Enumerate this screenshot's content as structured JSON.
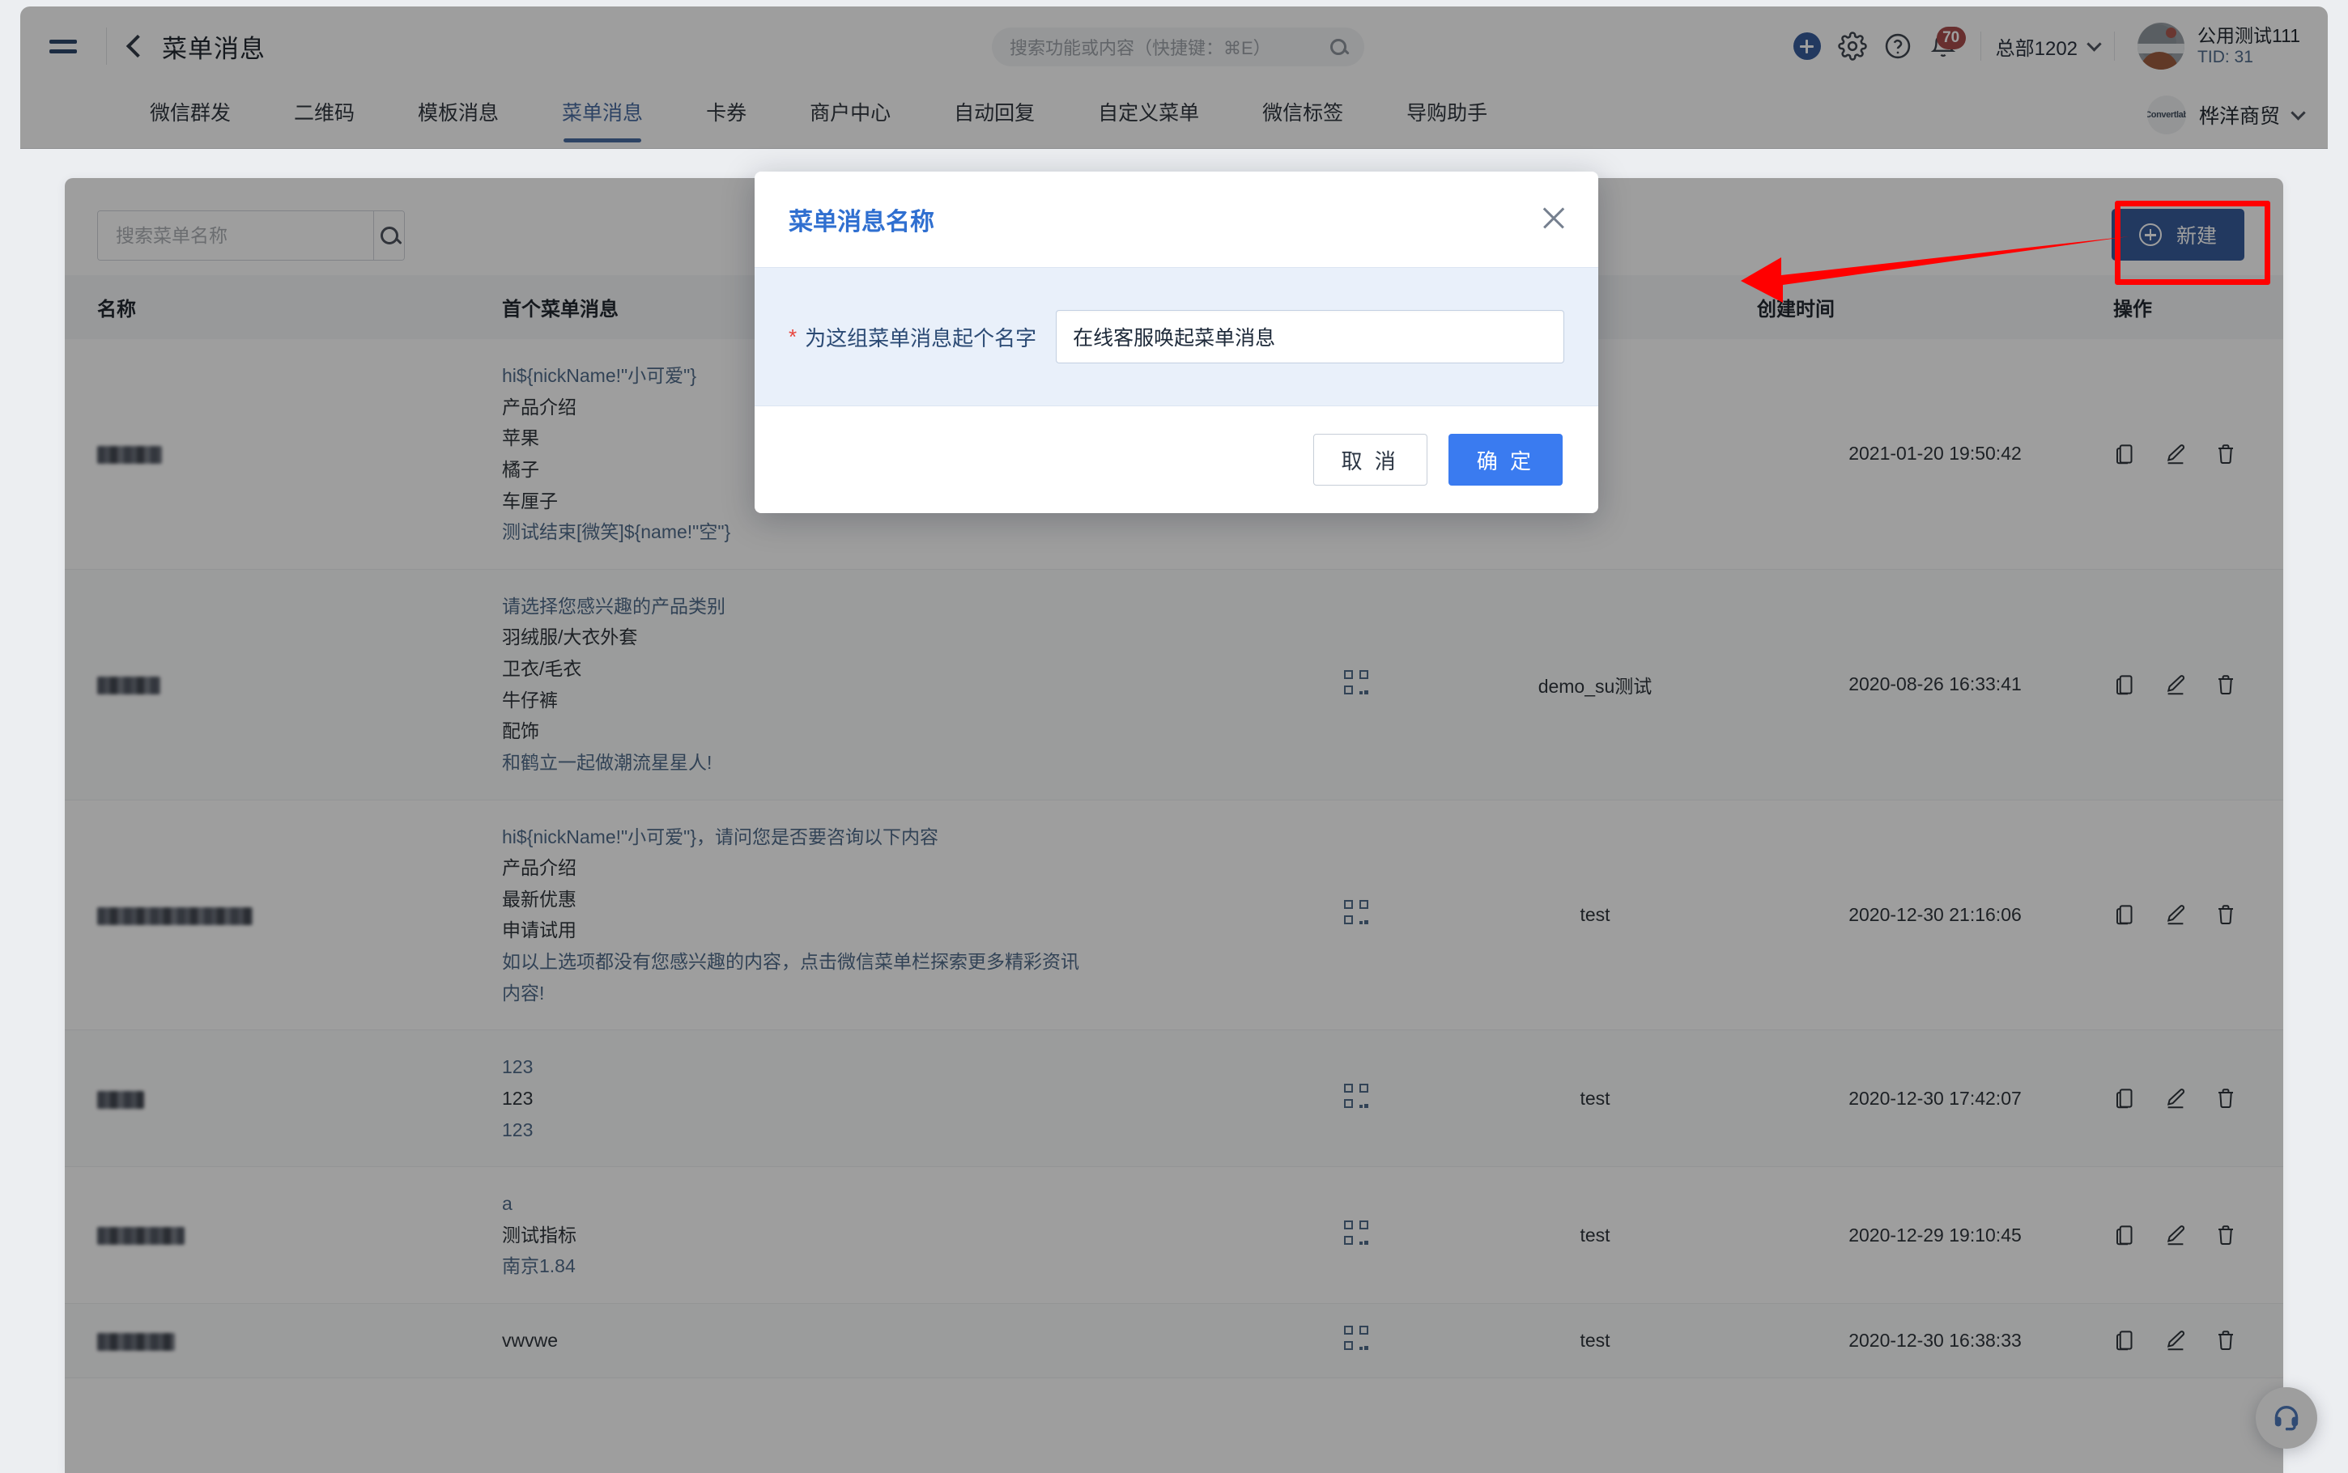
{
  "header": {
    "page_title": "菜单消息",
    "search_placeholder": "搜索功能或内容（快捷键：⌘E）",
    "notification_count": "70",
    "org_selector": "总部1202",
    "user_name": "公用测试111",
    "user_tid": "TID: 31"
  },
  "tabs": {
    "items": [
      {
        "label": "微信群发",
        "active": false
      },
      {
        "label": "二维码",
        "active": false
      },
      {
        "label": "模板消息",
        "active": false
      },
      {
        "label": "菜单消息",
        "active": true
      },
      {
        "label": "卡券",
        "active": false
      },
      {
        "label": "商户中心",
        "active": false
      },
      {
        "label": "自动回复",
        "active": false
      },
      {
        "label": "自定义菜单",
        "active": false
      },
      {
        "label": "微信标签",
        "active": false
      },
      {
        "label": "导购助手",
        "active": false
      }
    ],
    "brand_logo_text": "Convertlab",
    "brand_name": "桦洋商贸"
  },
  "toolbar": {
    "search_placeholder": "搜索菜单名称",
    "search_value": "",
    "new_button": "新建"
  },
  "table": {
    "columns": [
      "名称",
      "首个菜单消息",
      "",
      "",
      "创建时间",
      "操作"
    ],
    "rows": [
      {
        "name_redacted": true,
        "name_width": 80,
        "message_lines": [
          {
            "text": "hi${nickName!\"小可爱\"}",
            "style": "link"
          },
          {
            "text": "产品介绍",
            "style": "plain"
          },
          {
            "text": "苹果",
            "style": "plain"
          },
          {
            "text": "橘子",
            "style": "plain"
          },
          {
            "text": "车厘子",
            "style": "plain"
          },
          {
            "text": "测试结束[微笑]${name!\"空\"}",
            "style": "link"
          }
        ],
        "has_qr": false,
        "owner": "",
        "created_at": "2021-01-20 19:50:42"
      },
      {
        "name_redacted": true,
        "name_width": 78,
        "message_lines": [
          {
            "text": "请选择您感兴趣的产品类别",
            "style": "link"
          },
          {
            "text": "羽绒服/大衣外套",
            "style": "plain"
          },
          {
            "text": "卫衣/毛衣",
            "style": "plain"
          },
          {
            "text": "牛仔裤",
            "style": "plain"
          },
          {
            "text": "配饰",
            "style": "plain"
          },
          {
            "text": "和鹤立一起做潮流星星人!",
            "style": "link"
          }
        ],
        "has_qr": true,
        "owner": "demo_su测试",
        "created_at": "2020-08-26 16:33:41"
      },
      {
        "name_redacted": true,
        "name_width": 192,
        "message_lines": [
          {
            "text": "hi${nickName!\"小可爱\"}，请问您是否要咨询以下内容",
            "style": "link"
          },
          {
            "text": "产品介绍",
            "style": "plain"
          },
          {
            "text": "最新优惠",
            "style": "plain"
          },
          {
            "text": "申请试用",
            "style": "plain"
          },
          {
            "text": "如以上选项都没有您感兴趣的内容，点击微信菜单栏探索更多精彩资讯",
            "style": "link"
          },
          {
            "text": "内容!",
            "style": "link"
          }
        ],
        "has_qr": true,
        "owner": "test",
        "created_at": "2020-12-30 21:16:06"
      },
      {
        "name_redacted": true,
        "name_width": 58,
        "message_lines": [
          {
            "text": "123",
            "style": "link"
          },
          {
            "text": "123",
            "style": "plain"
          },
          {
            "text": "123",
            "style": "link"
          }
        ],
        "has_qr": true,
        "owner": "test",
        "created_at": "2020-12-30 17:42:07"
      },
      {
        "name_redacted": true,
        "name_width": 108,
        "message_lines": [
          {
            "text": "a",
            "style": "link"
          },
          {
            "text": "测试指标",
            "style": "plain"
          },
          {
            "text": "南京1.84",
            "style": "link"
          }
        ],
        "has_qr": true,
        "owner": "test",
        "created_at": "2020-12-29 19:10:45"
      },
      {
        "name_redacted": true,
        "name_width": 96,
        "message_lines": [
          {
            "text": "vwvwe",
            "style": "plain"
          }
        ],
        "has_qr": true,
        "owner": "test",
        "created_at": "2020-12-30 16:38:33"
      }
    ],
    "action_icons": [
      "copy-icon",
      "edit-icon",
      "delete-icon"
    ]
  },
  "modal": {
    "title": "菜单消息名称",
    "required_mark": "*",
    "field_label": "为这组菜单消息起个名字",
    "field_value": "在线客服唤起菜单消息",
    "cancel_label": "取 消",
    "confirm_label": "确 定"
  },
  "annotation": {
    "highlight_color": "#ff0000",
    "target": "新建"
  },
  "float_button": {
    "icon": "headset-icon"
  },
  "colors": {
    "accent": "#2f6fd0",
    "primary_button": "#1a5fd0",
    "confirm_button": "#3a7bf0",
    "badge": "#e23c3c",
    "modal_body_bg": "#e9f0fa"
  }
}
